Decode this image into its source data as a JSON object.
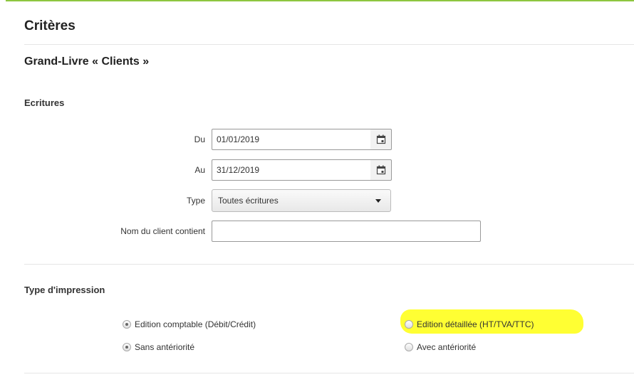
{
  "panel": {
    "title": "Critères"
  },
  "section": {
    "title": "Grand-Livre « Clients »"
  },
  "ecritures": {
    "title": "Ecritures",
    "du": {
      "label": "Du",
      "value": "01/01/2019"
    },
    "au": {
      "label": "Au",
      "value": "31/12/2019"
    },
    "type": {
      "label": "Type",
      "selected": "Toutes écritures"
    },
    "nom_client": {
      "label": "Nom du client contient",
      "value": ""
    }
  },
  "impression": {
    "title": "Type d'impression",
    "options": {
      "comptable": {
        "label": "Edition comptable (Débit/Crédit)",
        "checked": true
      },
      "detaillee": {
        "label": "Edition détaillée (HT/TVA/TTC)",
        "checked": false,
        "highlight_color": "#ffff33"
      },
      "sans_anteriorite": {
        "label": "Sans antériorité",
        "checked": true
      },
      "avec_anteriorite": {
        "label": "Avec antériorité",
        "checked": false
      }
    }
  },
  "colors": {
    "accent": "#8dc63f",
    "border": "#999999",
    "text": "#333333"
  },
  "icons": {
    "calendar": "calendar-icon",
    "dropdown": "caret-down-icon"
  }
}
